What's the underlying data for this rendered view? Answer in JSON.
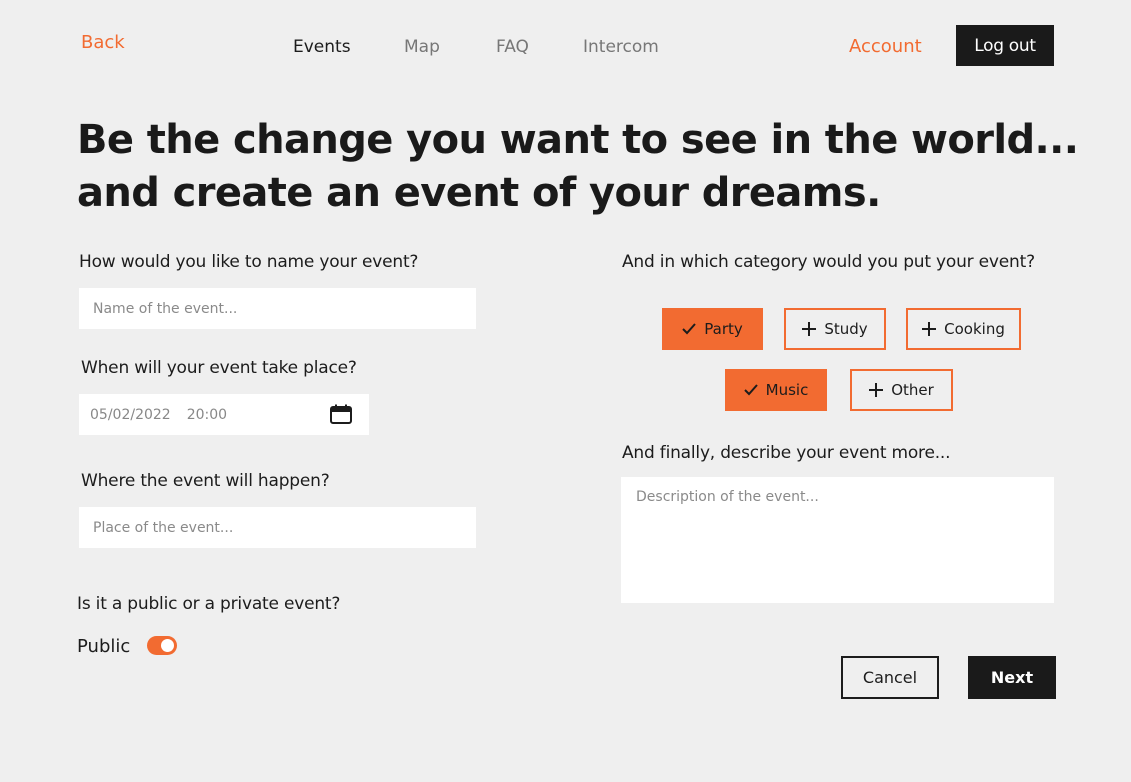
{
  "header": {
    "back_label": "Back",
    "nav": [
      {
        "label": "Events",
        "active": true
      },
      {
        "label": "Map",
        "active": false
      },
      {
        "label": "FAQ",
        "active": false
      },
      {
        "label": "Intercom",
        "active": false
      }
    ],
    "account_label": "Account",
    "logout_label": "Log out"
  },
  "hero": {
    "line1": "Be the change you want to see in the world...",
    "line2": "and create an event of your dreams."
  },
  "form": {
    "name": {
      "label": "How would you like to name your event?",
      "placeholder": "Name of the event...",
      "value": ""
    },
    "when": {
      "label": "When will your event take place?",
      "date": "05/02/2022",
      "time": "20:00",
      "icon": "calendar-icon"
    },
    "where": {
      "label": "Where the event will happen?",
      "placeholder": "Place of the event...",
      "value": ""
    },
    "visibility": {
      "label": "Is it a public or a private event?",
      "toggle_label": "Public",
      "is_public": true
    },
    "category": {
      "label": "And in which category would you put your event?",
      "options": [
        {
          "label": "Party",
          "selected": true
        },
        {
          "label": "Study",
          "selected": false
        },
        {
          "label": "Cooking",
          "selected": false
        },
        {
          "label": "Music",
          "selected": true
        },
        {
          "label": "Other",
          "selected": false
        }
      ]
    },
    "description": {
      "label": "And finally, describe your event more...",
      "placeholder": "Description of the event...",
      "value": ""
    }
  },
  "actions": {
    "cancel_label": "Cancel",
    "next_label": "Next"
  },
  "colors": {
    "accent": "#f26b31",
    "dark": "#1a1a1a",
    "background": "#efefef"
  }
}
